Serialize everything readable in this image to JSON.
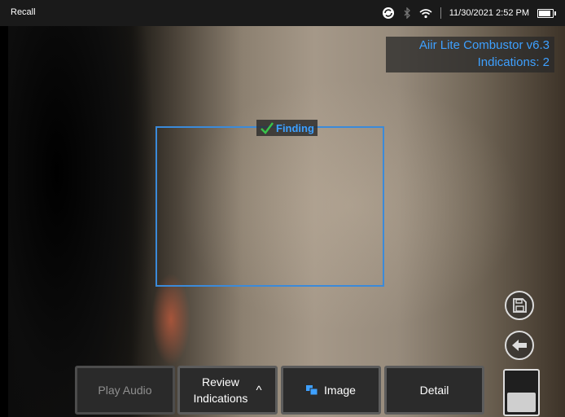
{
  "statusbar": {
    "title": "Recall",
    "datetime": "11/30/2021 2:52 PM",
    "icons": [
      "sync-icon",
      "bluetooth-icon",
      "wifi-icon",
      "battery-icon"
    ],
    "battery_level": 0.85
  },
  "overlay": {
    "line1": "Aiir Lite Combustor v6.3",
    "line2": "Indications: 2"
  },
  "finding": {
    "label": "Finding",
    "icon": "check-icon",
    "box_color": "#3b8ad9",
    "label_color": "#3ea0ff",
    "check_color": "#39c24a"
  },
  "toolbar": {
    "play_audio": "Play Audio",
    "review_line1": "Review",
    "review_line2": "Indications",
    "review_chevron": "^",
    "image": "Image",
    "detail": "Detail"
  },
  "side_controls": {
    "save_icon": "save-icon",
    "back_icon": "arrow-left-icon"
  }
}
